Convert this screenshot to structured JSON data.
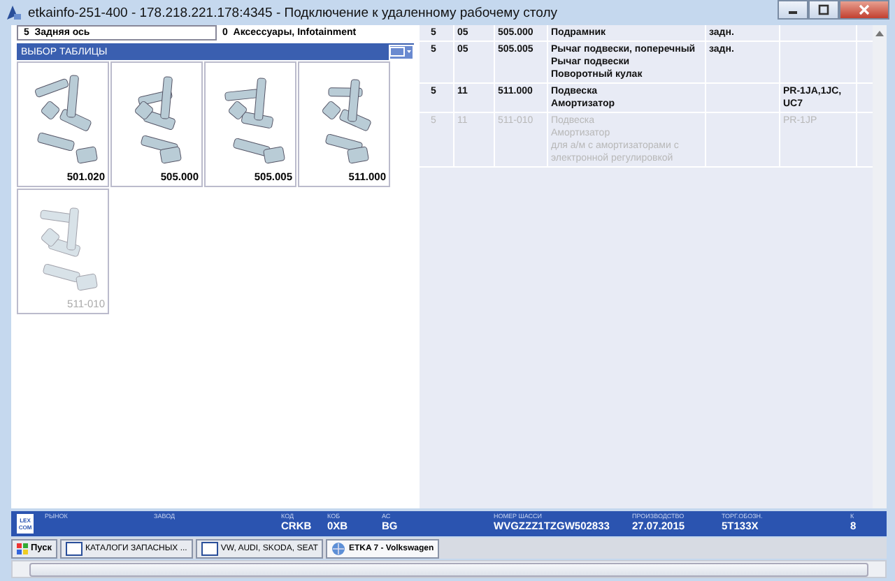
{
  "window": {
    "title": "etkainfo-251-400 - 178.218.221.178:4345 - Подключение к удаленному рабочему столу"
  },
  "filters": [
    {
      "code": "5",
      "label": "Задняя ось"
    },
    {
      "code": "0",
      "label": "Аксессуары, Infotainment"
    }
  ],
  "table_select": {
    "title": "ВЫБОР ТАБЛИЦЫ",
    "items": [
      {
        "kind": "picture",
        "label": "501.020",
        "disabled": false
      },
      {
        "kind": "picture",
        "label": "505.000",
        "disabled": false
      },
      {
        "kind": "picture",
        "label": "505.005",
        "disabled": false
      },
      {
        "kind": "picture",
        "label": "511.000",
        "disabled": false
      },
      {
        "kind": "picture",
        "label": "511-010",
        "disabled": true
      }
    ]
  },
  "parts": {
    "rows": [
      {
        "column_1": "5",
        "column_2": "05",
        "column_3": "505.000",
        "names": [
          "Подрамник"
        ],
        "column_5": "задн.",
        "column_6": "",
        "disabled": false
      },
      {
        "column_1": "5",
        "column_2": "05",
        "column_3": "505.005",
        "names": [
          "Рычаг подвески, поперечный",
          "Рычаг подвески",
          "Поворотный кулак"
        ],
        "column_5": "задн.",
        "column_6": "",
        "disabled": false
      },
      {
        "column_1": "5",
        "column_2": "11",
        "column_3": "511.000",
        "names": [
          "Подвеска",
          "Амортизатор"
        ],
        "column_5": "",
        "column_6": "PR-1JA,1JC, UC7",
        "disabled": false
      },
      {
        "column_1": "5",
        "column_2": "11",
        "column_3": "511-010",
        "names": [
          "Подвеска",
          "Амортизатор",
          "для а/м с амортизаторами с",
          "электронной регулировкой"
        ],
        "column_5": "",
        "column_6": "PR-1JP",
        "disabled": true
      }
    ]
  },
  "info_bar": {
    "logo": [
      "LEX",
      "COM"
    ],
    "fields": [
      {
        "label": "РЫНОК"
      },
      {
        "label": "ЗАВОД"
      },
      {
        "label": "КОД",
        "value": "CRKB"
      },
      {
        "label": "КОБ",
        "value": "0XB"
      },
      {
        "label": "АС",
        "value": "BG"
      },
      {
        "label": "НОМЕР ШАССИ",
        "value": "WVGZZZ1TZGW502833"
      },
      {
        "label": "ПРОИЗВОДСТВО",
        "value": "27.07.2015"
      },
      {
        "label": "ТОРГ.ОБОЗН.",
        "value": "5T133X"
      },
      {
        "label": "К",
        "value": "8"
      }
    ]
  },
  "taskbar": {
    "start": "Пуск",
    "items": [
      {
        "label": "КАТАЛОГИ ЗАПАСНЫХ ...",
        "selected": false
      },
      {
        "label": "VW, AUDI, SKODA, SEAT",
        "selected": false
      },
      {
        "label": "ETKA 7 - Volkswagen",
        "selected": true
      }
    ]
  }
}
